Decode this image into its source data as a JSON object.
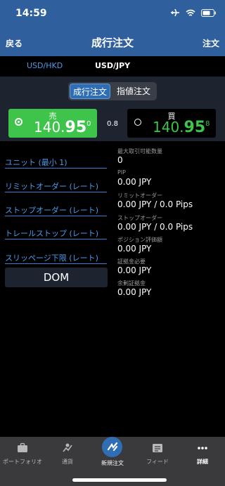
{
  "status": {
    "time": "14:59"
  },
  "nav": {
    "back": "戻る",
    "title": "成行注文",
    "order": "注文"
  },
  "pairs": [
    "USD/HKD",
    "USD/JPY"
  ],
  "order_type": {
    "market": "成行注文",
    "limit": "指値注文"
  },
  "sell": {
    "label": "売",
    "price_main": "140.",
    "price_big": "95",
    "price_sup": "0"
  },
  "spread": "0.8",
  "buy": {
    "label": "買",
    "price_main": "140.",
    "price_big": "95",
    "price_sup": "8"
  },
  "fields": [
    "ユニット (最小 1)",
    "リミットオーダー (レート)",
    "ストップオーダー (レート)",
    "トレールストップ (レート)",
    "スリッページ下限 (レート)"
  ],
  "dom_button": "DOM",
  "info": [
    {
      "label": "最大取引可能数量",
      "value": "0"
    },
    {
      "label": "PIP",
      "value": "0.00 JPY"
    },
    {
      "label": "リミットオーダー",
      "value": "0.00 JPY / 0.0 Pips"
    },
    {
      "label": "ストップオーダー",
      "value": "0.00 JPY / 0.0 Pips"
    },
    {
      "label": "ポジション評価額",
      "value": "0.00 JPY"
    },
    {
      "label": "証拠金必要",
      "value": "0.00 JPY"
    },
    {
      "label": "余剰証拠金",
      "value": "0.00 JPY"
    }
  ],
  "tabs": [
    "ポートフォリオ",
    "通貨",
    "新規注文",
    "フィード",
    "詳細"
  ],
  "colors": {
    "header": "#2f5f9c",
    "accent": "#4d9ae8",
    "sell": "#3ec34b",
    "panel": "#1d2430"
  }
}
